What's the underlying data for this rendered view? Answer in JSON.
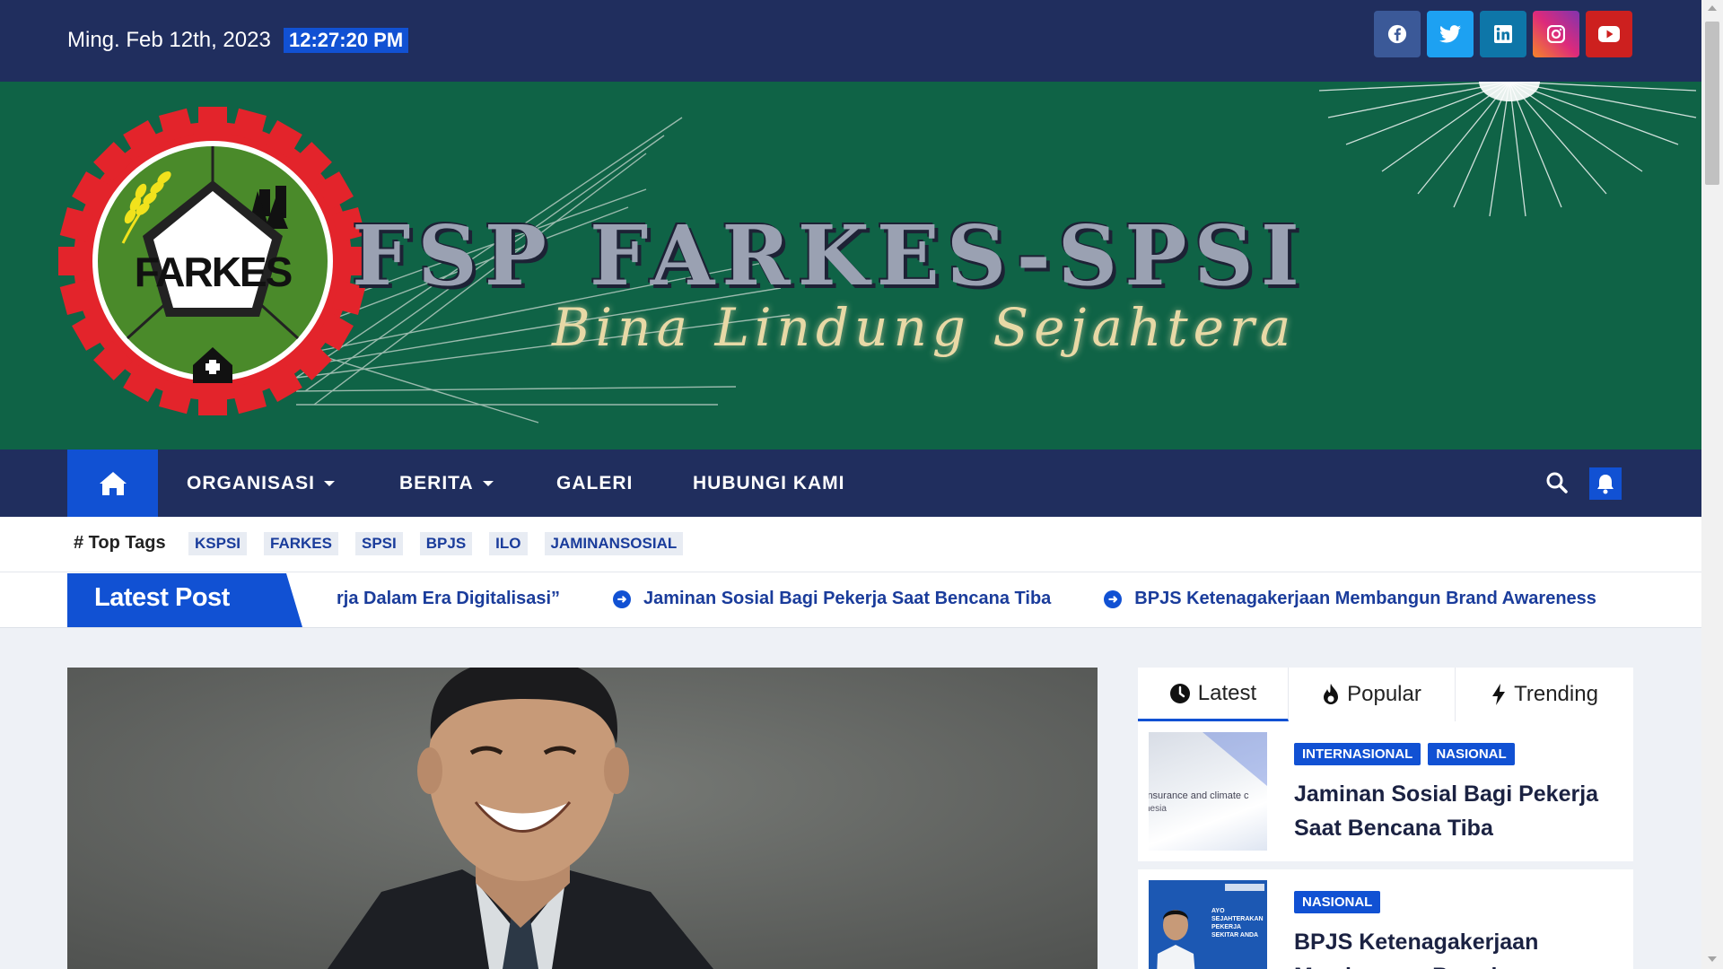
{
  "topbar": {
    "date": "Ming. Feb 12th, 2023",
    "time": "12:27:20 PM",
    "socials": [
      {
        "name": "facebook",
        "icon": "facebook-icon",
        "color": "#3b5998",
        "glyph": "f"
      },
      {
        "name": "twitter",
        "icon": "twitter-icon",
        "color": "#1da1f2",
        "glyph": "t"
      },
      {
        "name": "linkedin",
        "icon": "linkedin-icon",
        "color": "#0e76a8",
        "glyph": "in"
      },
      {
        "name": "instagram",
        "icon": "instagram-icon",
        "color": "#e1306c",
        "glyph": "◎"
      },
      {
        "name": "youtube",
        "icon": "youtube-icon",
        "color": "#cd201f",
        "glyph": "▶"
      }
    ]
  },
  "banner": {
    "logo_text": "FARKES",
    "title": "FSP FARKES-SPSI",
    "tagline": "Bina Lindung Sejahtera"
  },
  "nav": {
    "items": [
      {
        "label": "ORGANISASI",
        "dropdown": true
      },
      {
        "label": "BERITA",
        "dropdown": true
      },
      {
        "label": "GALERI",
        "dropdown": false
      },
      {
        "label": "HUBUNGI KAMI",
        "dropdown": false
      }
    ]
  },
  "tags": {
    "label": "# Top Tags",
    "items": [
      "KSPSI",
      "FARKES",
      "SPSI",
      "BPJS",
      "ILO",
      "JAMINANSOSIAL"
    ]
  },
  "ticker": {
    "heading": "Latest Post",
    "items": [
      "rja Dalam Era Digitalisasi”",
      "Jaminan Sosial Bagi Pekerja Saat Bencana Tiba",
      "BPJS Ketenagakerjaan Membangun Brand Awareness"
    ]
  },
  "sidebar": {
    "tabs": [
      {
        "label": "Latest",
        "icon": "clock-icon",
        "active": true
      },
      {
        "label": "Popular",
        "icon": "fire-icon",
        "active": false
      },
      {
        "label": "Trending",
        "icon": "bolt-icon",
        "active": false
      }
    ],
    "posts": [
      {
        "categories": [
          "INTERNASIONAL",
          "NASIONAL"
        ],
        "title": "Jaminan Sosial Bagi Pekerja Saat Bencana Tiba",
        "thumb_text": "insurance and climate c nesia"
      },
      {
        "categories": [
          "NASIONAL"
        ],
        "title": "BPJS Ketenagakerjaan Membangun Brand",
        "thumb_text": "AYO SEJAHTERAKAN PEKERJA SEKITAR ANDA"
      }
    ]
  },
  "colors": {
    "navy": "#202e5e",
    "accent": "#1151d3",
    "banner_green": "#0f6346"
  }
}
